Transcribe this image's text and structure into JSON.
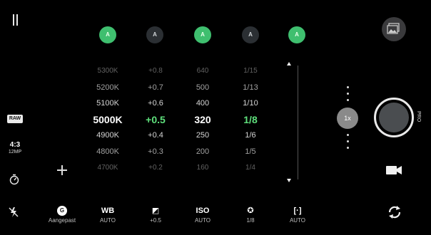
{
  "left_rail": {
    "raw_badge": "RAW",
    "aspect_ratio": "4:3",
    "resolution": "12MP"
  },
  "auto_indicators": [
    {
      "label": "A",
      "active": true
    },
    {
      "label": "A",
      "active": false
    },
    {
      "label": "A",
      "active": true
    },
    {
      "label": "A",
      "active": false
    },
    {
      "label": "A",
      "active": true
    }
  ],
  "columns": {
    "white_balance": [
      "5300K",
      "5200K",
      "5100K",
      "5000K",
      "4900K",
      "4800K",
      "4700K"
    ],
    "exposure": [
      "+0.8",
      "+0.7",
      "+0.6",
      "+0.5",
      "+0.4",
      "+0.3",
      "+0.2"
    ],
    "iso": [
      "640",
      "500",
      "400",
      "320",
      "250",
      "200",
      "160"
    ],
    "shutter": [
      "1/15",
      "1/13",
      "1/10",
      "1/8",
      "1/6",
      "1/5",
      "1/4"
    ],
    "selected_index": 3
  },
  "zoom": {
    "label": "1x"
  },
  "side": {
    "pro_label": "PRO"
  },
  "bottom_bar": {
    "mode": {
      "icon": "G",
      "label": "Aangepast"
    },
    "wb": {
      "icon": "WB",
      "label": "AUTO"
    },
    "ev": {
      "icon": "◩",
      "label": "+0.5"
    },
    "iso": {
      "icon": "ISO",
      "label": "AUTO"
    },
    "shutter": {
      "icon": "✪",
      "label": "1/8"
    },
    "focus": {
      "icon": "[·]",
      "label": "AUTO"
    }
  },
  "colors": {
    "accent_green": "#3fbf6f",
    "selected_green": "#5fe07c"
  }
}
